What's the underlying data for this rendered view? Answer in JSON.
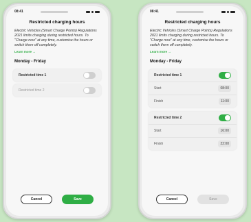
{
  "status_time": "08:41",
  "left": {
    "title": "Restricted charging hours",
    "description": "Electric Vehicles (Smart Charge Points) Regulations 2021 limits charging during restricted hours. To \"Charge now\" at any time, customise the hours or switch them off completely.",
    "learn_more": "Learn more →",
    "section": "Monday - Friday",
    "items": [
      {
        "label": "Restricted time 1",
        "enabled": false
      },
      {
        "label": "Restricted time 2",
        "enabled": false
      }
    ],
    "cancel": "Cancel",
    "save": "Save"
  },
  "right": {
    "title": "Restricted charging hours",
    "description": "Electric Vehicles (Smart Charge Points) Regulations 2021 limits charging during restricted hours. To \"Charge now\" at any time, customise the hours or switch them off completely.",
    "learn_more": "Learn more →",
    "section": "Monday - Friday",
    "time1": {
      "label": "Restricted time 1",
      "enabled": true,
      "start_label": "Start",
      "start": "08:00",
      "finish_label": "Finish",
      "finish": "11:00"
    },
    "time2": {
      "label": "Restricted time 2",
      "enabled": true,
      "start_label": "Start",
      "start": "16:00",
      "finish_label": "Finish",
      "finish": "22:00"
    },
    "cancel": "Cancel",
    "save": "Save"
  },
  "colors": {
    "accent": "#2fae45",
    "background": "#c7e6c2"
  }
}
